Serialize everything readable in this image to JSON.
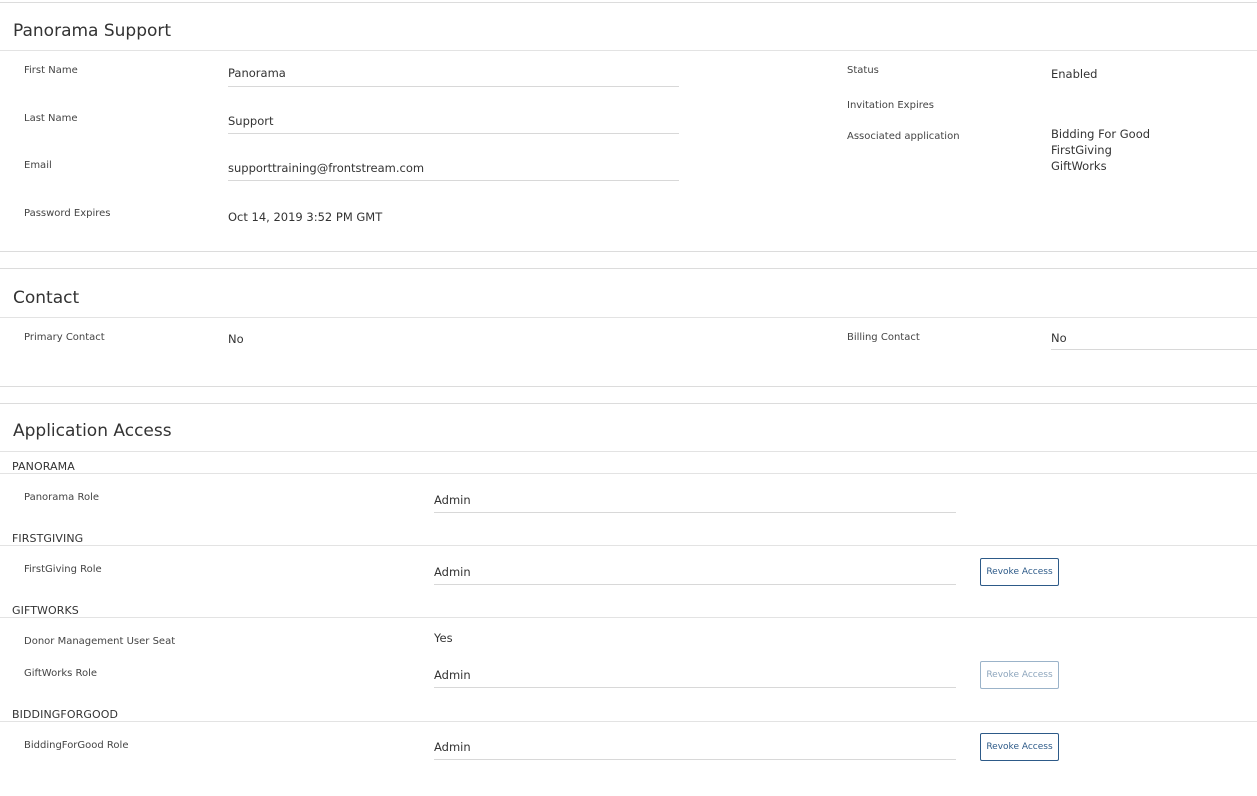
{
  "profile": {
    "title": "Panorama Support",
    "first_name_label": "First Name",
    "first_name_value": "Panorama",
    "last_name_label": "Last Name",
    "last_name_value": "Support",
    "email_label": "Email",
    "email_value": "supporttraining@frontstream.com",
    "password_expires_label": "Password Expires",
    "password_expires_value": "Oct 14, 2019 3:52 PM GMT",
    "status_label": "Status",
    "status_value": "Enabled",
    "invitation_expires_label": "Invitation Expires",
    "associated_app_label": "Associated application",
    "associated_apps": [
      "Bidding For Good",
      "FirstGiving",
      "GiftWorks"
    ]
  },
  "contact": {
    "title": "Contact",
    "primary_label": "Primary Contact",
    "primary_value": "No",
    "billing_label": "Billing Contact",
    "billing_value": "No"
  },
  "access": {
    "title": "Application Access",
    "panorama": {
      "header": "PANORAMA",
      "role_label": "Panorama Role",
      "role_value": "Admin"
    },
    "firstgiving": {
      "header": "FIRSTGIVING",
      "role_label": "FirstGiving Role",
      "role_value": "Admin",
      "revoke_label": "Revoke Access"
    },
    "giftworks": {
      "header": "GIFTWORKS",
      "seat_label": "Donor Management User Seat",
      "seat_value": "Yes",
      "role_label": "GiftWorks Role",
      "role_value": "Admin",
      "revoke_label": "Revoke Access"
    },
    "biddingforgood": {
      "header": "BIDDINGFORGOOD",
      "role_label": "BiddingForGood Role",
      "role_value": "Admin",
      "revoke_label": "Revoke Access"
    }
  }
}
